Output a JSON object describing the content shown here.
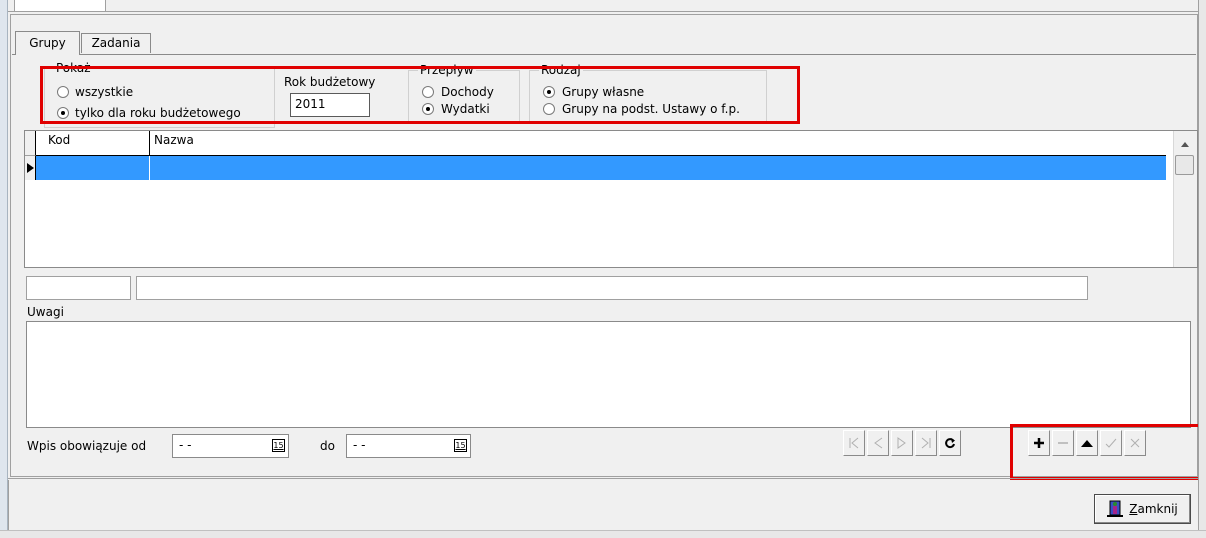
{
  "tabs": [
    {
      "label": "Grupy",
      "active": true
    },
    {
      "label": "Zadania",
      "active": false
    }
  ],
  "filters": {
    "pokaz": {
      "legend": "Pokaż",
      "options": [
        {
          "label": "wszystkie",
          "selected": false
        },
        {
          "label": "tylko dla roku budżetowego",
          "selected": true
        }
      ]
    },
    "rok": {
      "label": "Rok budżetowy",
      "value": "2011"
    },
    "przeplyw": {
      "legend": "Przepływ",
      "options": [
        {
          "label": "Dochody",
          "selected": false
        },
        {
          "label": "Wydatki",
          "selected": true
        }
      ]
    },
    "rodzaj": {
      "legend": "Rodzaj",
      "options": [
        {
          "label": "Grupy własne",
          "selected": true
        },
        {
          "label": "Grupy na podst. Ustawy o f.p.",
          "selected": false
        }
      ]
    }
  },
  "grid": {
    "columns": [
      "Kod",
      "Nazwa"
    ],
    "rows": [
      {
        "kod": "",
        "nazwa": "",
        "selected": true
      }
    ]
  },
  "detail": {
    "kod_value": "",
    "nazwa_value": ""
  },
  "uwagi": {
    "label": "Uwagi",
    "value": ""
  },
  "wpis": {
    "label_from": "Wpis obowiązuje od",
    "from_value": " - -",
    "label_to": "do",
    "to_value": " - -",
    "calendar_glyph": "15"
  },
  "navigator": {
    "buttons": [
      {
        "name": "first-record-button",
        "icon": "first-icon",
        "enabled": false
      },
      {
        "name": "prior-record-button",
        "icon": "prior-icon",
        "enabled": false
      },
      {
        "name": "next-record-button",
        "icon": "next-icon",
        "enabled": false
      },
      {
        "name": "last-record-button",
        "icon": "last-icon",
        "enabled": false
      },
      {
        "name": "refresh-button",
        "icon": "refresh-icon",
        "enabled": true
      }
    ],
    "edit_buttons": [
      {
        "name": "insert-button",
        "icon": "plus-icon",
        "enabled": true
      },
      {
        "name": "delete-button",
        "icon": "minus-icon",
        "enabled": false
      },
      {
        "name": "edit-button",
        "icon": "up-triangle-icon",
        "enabled": true
      },
      {
        "name": "post-button",
        "icon": "check-icon",
        "enabled": false
      },
      {
        "name": "cancel-button",
        "icon": "x-icon",
        "enabled": false
      }
    ]
  },
  "close_button": {
    "label": "Zamknij",
    "accelerator": "Z",
    "label_rest": "amknij",
    "icon": "door-exit-icon"
  },
  "colors": {
    "highlight_box": "#e00000",
    "selection": "#3399ff",
    "face": "#f0f0f0"
  }
}
